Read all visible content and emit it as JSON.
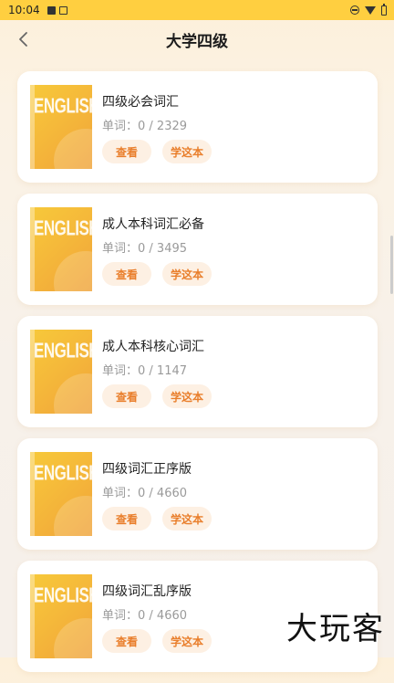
{
  "status_bar": {
    "time": "10:04"
  },
  "header": {
    "title": "大学四级"
  },
  "books": [
    {
      "cover_text": "ENGLISH",
      "title": "四级必会词汇",
      "count_label": "单词：",
      "count": "0 / 2329",
      "view_label": "查看",
      "study_label": "学这本"
    },
    {
      "cover_text": "ENGLISH",
      "title": "成人本科词汇必备",
      "count_label": "单词：",
      "count": "0 / 3495",
      "view_label": "查看",
      "study_label": "学这本"
    },
    {
      "cover_text": "ENGLISH",
      "title": "成人本科核心词汇",
      "count_label": "单词：",
      "count": "0 / 1147",
      "view_label": "查看",
      "study_label": "学这本"
    },
    {
      "cover_text": "ENGLISH",
      "title": "四级词汇正序版",
      "count_label": "单词：",
      "count": "0 / 4660",
      "view_label": "查看",
      "study_label": "学这本"
    },
    {
      "cover_text": "ENGLISH",
      "title": "四级词汇乱序版",
      "count_label": "单词：",
      "count": "0 / 4660",
      "view_label": "查看",
      "study_label": "学这本"
    }
  ],
  "watermark": "大玩客",
  "colors": {
    "accent": "#e97e2b",
    "status_bar": "#ffcf40",
    "button_bg": "#fdf0e3"
  }
}
